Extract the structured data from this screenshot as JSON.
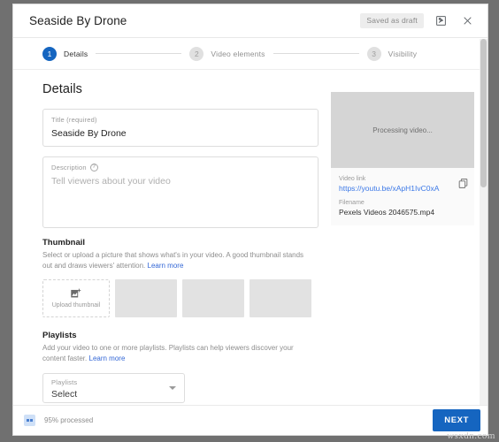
{
  "header": {
    "title": "Seaside By Drone",
    "saved_badge": "Saved as draft",
    "feedback_icon": "feedback-icon",
    "close_icon": "close-icon"
  },
  "stepper": {
    "steps": [
      {
        "num": "1",
        "label": "Details",
        "active": true
      },
      {
        "num": "2",
        "label": "Video elements",
        "active": false
      },
      {
        "num": "3",
        "label": "Visibility",
        "active": false
      }
    ]
  },
  "details": {
    "section_title": "Details",
    "title_field": {
      "label": "Title (required)",
      "value": "Seaside By Drone"
    },
    "description_field": {
      "label": "Description",
      "help_icon": "help-icon",
      "placeholder": "Tell viewers about your video"
    }
  },
  "thumbnail": {
    "title": "Thumbnail",
    "description": "Select or upload a picture that shows what's in your video. A good thumbnail stands out and draws viewers' attention.",
    "learn_more": "Learn more",
    "upload_label": "Upload thumbnail",
    "upload_icon": "image-add-icon",
    "placeholders": 3
  },
  "playlists": {
    "title": "Playlists",
    "description": "Add your video to one or more playlists. Playlists can help viewers discover your content faster.",
    "learn_more": "Learn more",
    "select_label": "Playlists",
    "select_value": "Select",
    "caret_icon": "chevron-down-icon"
  },
  "video_panel": {
    "processing_text": "Processing video...",
    "video_link_label": "Video link",
    "video_link": "https://youtu.be/xApH1IvC0xA",
    "filename_label": "Filename",
    "filename": "Pexels Videos 2046575.mp4",
    "copy_icon": "copy-icon"
  },
  "footer": {
    "processed_text": "95% processed",
    "processing_icon": "processing-icon",
    "next_label": "NEXT"
  },
  "watermark": "wsxdn.com",
  "colors": {
    "accent": "#1565c0",
    "link": "#3b78e7",
    "placeholder": "#d5d5d5"
  }
}
